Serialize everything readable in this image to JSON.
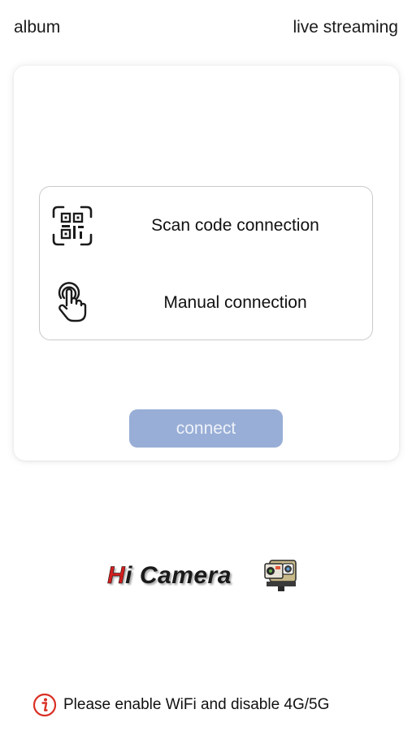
{
  "header": {
    "left_label": "album",
    "right_label": "live streaming"
  },
  "connection": {
    "options": [
      {
        "label": "Scan code connection",
        "icon": "qr-scan-icon"
      },
      {
        "label": "Manual connection",
        "icon": "hand-tap-icon"
      }
    ],
    "connect_label": "connect"
  },
  "logo": {
    "h": "H",
    "rest": "i Camera",
    "icon": "action-camera-icon"
  },
  "footer": {
    "message": "Please enable WiFi and disable 4G/5G",
    "icon": "info-icon"
  },
  "colors": {
    "connect_button": "#98aed6",
    "logo_h": "#d01e1e",
    "info_icon": "#d93025"
  }
}
